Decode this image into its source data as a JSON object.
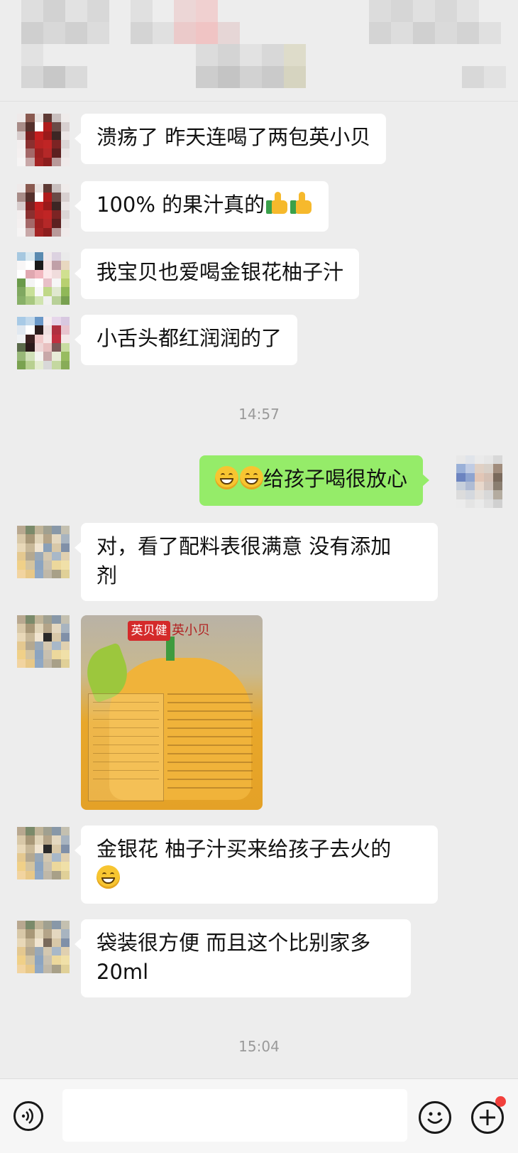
{
  "messages": [
    {
      "id": "m1",
      "side": "left",
      "text": "溃疡了  昨天连喝了两包英小贝"
    },
    {
      "id": "m2",
      "side": "left",
      "text": "100% 的果汁真的",
      "emoji": [
        "thumbs-up",
        "thumbs-up"
      ]
    },
    {
      "id": "m3",
      "side": "left",
      "text": "我宝贝也爱喝金银花柚子汁"
    },
    {
      "id": "m4",
      "side": "left",
      "text": "小舌头都红润润的了"
    },
    {
      "id": "t1",
      "type": "time",
      "text": "14:57"
    },
    {
      "id": "m5",
      "side": "right",
      "text": "给孩子喝很放心",
      "emoji": [
        "grin",
        "grin"
      ]
    },
    {
      "id": "m6",
      "side": "left",
      "line1": "对，看了配料表很满意  没有添加",
      "line2": "剂"
    },
    {
      "id": "m7",
      "side": "left",
      "type": "image",
      "brand_tag": "英贝健",
      "brand_name": "英小贝"
    },
    {
      "id": "m8",
      "side": "left",
      "line1": "金银花  柚子汁买来给孩子去火的",
      "emoji": [
        "grin"
      ]
    },
    {
      "id": "m9",
      "side": "left",
      "line1": "袋装很方便  而且这个比别家多",
      "line2": "20ml"
    },
    {
      "id": "t2",
      "type": "time",
      "text": "15:04"
    }
  ],
  "input": {
    "placeholder": "",
    "value": ""
  },
  "icons": {
    "voice": "voice-icon",
    "emoji": "emoji-icon",
    "plus": "plus-icon",
    "notify": "red-dot-icon"
  },
  "colors": {
    "background": "#ededed",
    "bubble_left": "#ffffff",
    "bubble_right": "#95ec69",
    "timestamp": "#9a9a9a"
  }
}
